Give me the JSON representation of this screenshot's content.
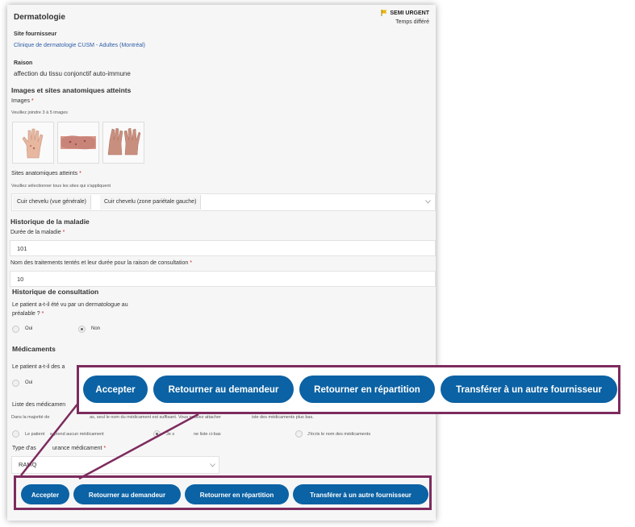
{
  "header": {
    "title": "Dermatologie",
    "urgency": "SEMI URGENT",
    "delay": "Temps différé",
    "flag_color": "#e8b400"
  },
  "provider": {
    "label": "Site fournisseur",
    "value": "Clinique de dermatologie CUSM - Adultes (Montréal)"
  },
  "reason": {
    "label": "Raison",
    "value": "affection du tissu conjonctif auto-immune"
  },
  "images_section": {
    "title": "Images et sites anatomiques atteints",
    "images_label": "Images",
    "required_mark": "*",
    "images_hint": "Veuillez joindre 3 à 5 images",
    "thumbnails": [
      "hand-photo-1",
      "hands-photo-2",
      "hands-photo-3"
    ]
  },
  "sites": {
    "label": "Sites anatomiques atteints",
    "hint": "Veuillez sélectionner tous les sites qui s'appliquent",
    "chips": [
      "Cuir chevelu (vue générale)",
      "Cuir chevelu (zone pariétale gauche)"
    ]
  },
  "history": {
    "title": "Historique de la maladie",
    "duration_label": "Durée de la maladie",
    "duration_value": "101",
    "treatments_label": "Nom des traitements tentés et leur durée pour la raison de consultation",
    "treatments_value": "10"
  },
  "consultation": {
    "title": "Historique de consultation",
    "question_line1": "Le patient a-t-il été vu par un dermatologue au",
    "question_line2": "préalable ?",
    "options": [
      "Oui",
      "Non"
    ],
    "selected": "Non"
  },
  "medications": {
    "title": "Médicaments",
    "question": "Le patient a-t-il des a",
    "option_yes": "Oui",
    "list_label": "Liste des médicamen",
    "hint_start": "Dans la majorité de",
    "hint_mid": "as, seul le nom du médicament est suffisant. Vous pouvez attacher",
    "hint_end": "iste des médicaments plus bas.",
    "opt_none_a": "Le patient",
    "opt_none_b": "e prend aucun médicament",
    "opt_list_a": "Je s",
    "opt_list_b": "ne liste ci-bas",
    "opt_write": "J'écris le nom des médicaments",
    "insurance_label_a": "Type d'as",
    "insurance_label_b": "urance médicament",
    "insurance_value": "RAMQ"
  },
  "actions": {
    "accept": "Accepter",
    "return_requester": "Retourner au demandeur",
    "return_dispatch": "Retourner en répartition",
    "transfer": "Transférer à un autre fournisseur",
    "button_color": "#0b62a4",
    "highlight_color": "#7d2b5e"
  }
}
